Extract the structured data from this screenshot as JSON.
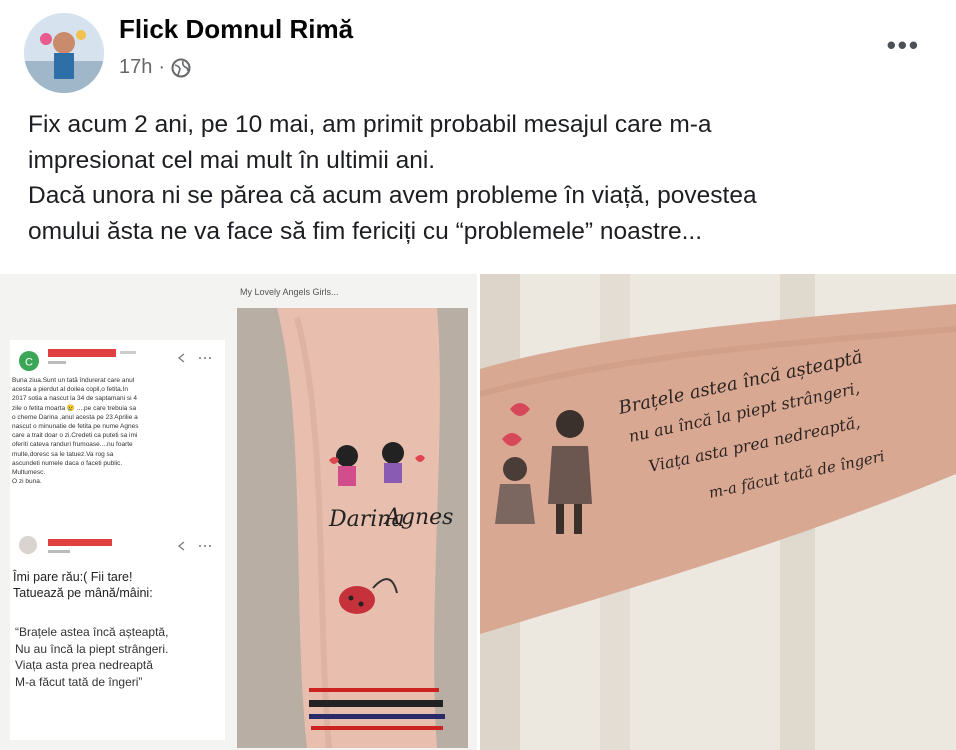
{
  "post": {
    "author": "Flick Domnul Rimă",
    "time": "17h",
    "privacy_icon": "globe-icon",
    "more_label": "•••",
    "text_lines": [
      "Fix acum 2 ani, pe 10 mai, am primit probabil mesajul care m-a",
      "impresionat cel mai mult în ultimii ani.",
      "Dacă unora ni se părea că acum avem probleme în viață, povestea",
      "omului ăsta ne va face să fim fericiți cu “problemele” noastre..."
    ]
  },
  "left_image": {
    "caption": "My Lovely Angels Girls...",
    "avatar_letter": "C",
    "message_lines": [
      "Buna ziua.Sunt un tată îndurerat care anul",
      "acesta a pierdut al doilea copil,o fetita.In",
      "2017 sotia a nascut la 34 de saptamani si 4",
      "zile o fetita moarta 😢 ....pe care trebuia sa",
      "o cheme Darina ,anul acesta pe 23 Aprilie a",
      "nascut o minunatie de fetita pe nume Agnes",
      "care a trait doar o zi.Credeti ca puteti sa imi",
      "oferiti cateva randuri frumoase....nu foarte",
      "multe,doresc sa le tatuez.Va rog sa",
      "ascundeti numele daca o faceti public.",
      "Multumesc.",
      "O zi buna."
    ],
    "reply_lines": [
      "Îmi pare rău:( Fii tare!",
      "Tatuează pe mână/mâini:"
    ],
    "quote_lines": [
      "“Brațele astea încă așteaptă,",
      "Nu au încă la piept strângeri.",
      "Viața asta prea nedreaptă",
      "M-a făcut tată de îngeri”"
    ],
    "tattoo_names": [
      "Darina",
      "Agnes"
    ]
  },
  "right_image": {
    "tattoo_lines": [
      "Brațele astea încă așteaptă",
      "nu au încă la piept strângeri,",
      "Viața asta prea nedreaptă,",
      "m-a făcut tată de îngeri"
    ]
  }
}
